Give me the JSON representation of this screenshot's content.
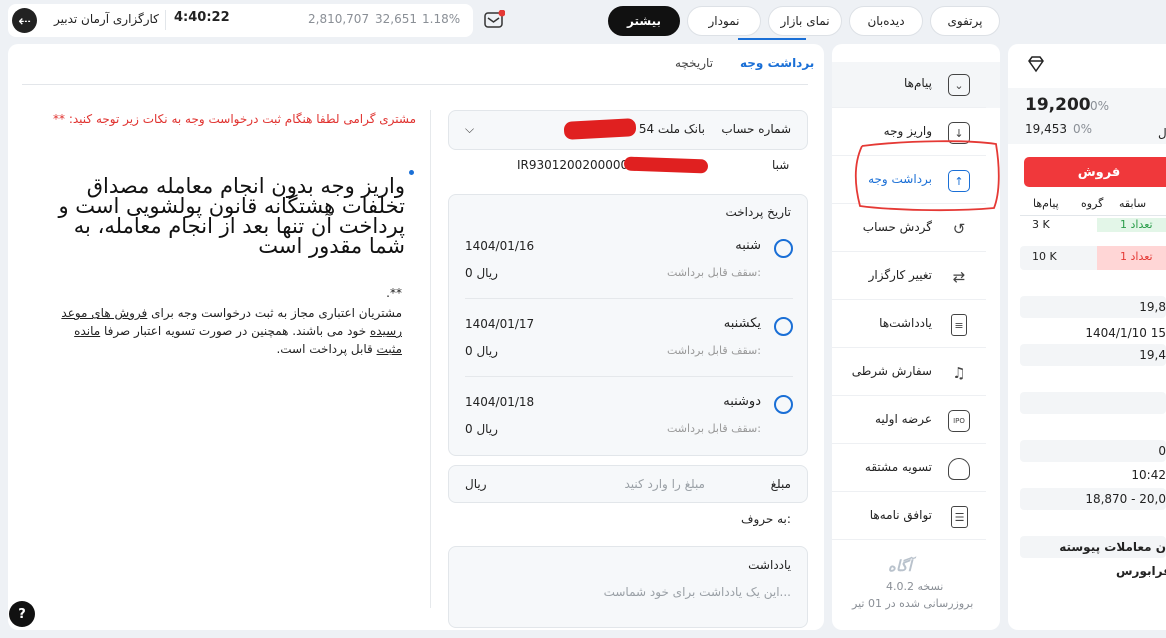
{
  "topbar": {
    "broker": "کارگزاری آرمان تدبیر",
    "time": "4:40:22",
    "index_value": "2,810,707",
    "index_change": "32,651",
    "index_percent": "1.18%"
  },
  "nav": {
    "more": "بیشتر",
    "chart": "نمودار",
    "market_view": "نمای بازار",
    "watch": "دیده‌بان",
    "portfolio": "پرتفوی"
  },
  "tabs": {
    "withdraw": "برداشت وجه",
    "history": "تاریخچه"
  },
  "notice": {
    "intro": "مشتری گرامی لطفا هنگام ثبت درخواست وجه به نکات زیر توجه کنید: **",
    "big_text": "واریز وجه بدون انجام معامله مصداق تخلفات هشتگانه قانون پولشویی است و پرداخت آن تنها بعد از انجام معامله، به شما مقدور است",
    "stars": "**.",
    "p1_a": "مشتریان اعتباری مجاز به ثبت درخواست وجه برای",
    "p1_link": "فروش های موعد رسیده",
    "p1_b": "خود می باشند. همچنین در صورت تسویه اعتبار صرفا",
    "p1_link2": "مانده مثبت",
    "p1_c": "قابل پرداخت است."
  },
  "form": {
    "account_label": "شماره حساب",
    "account_value": "بانک ملت 54",
    "sheba_label": "شبا",
    "sheba_value": "IR9301200200000",
    "pay_date_label": "تاریخ پرداخت",
    "dates": [
      {
        "day": "شنبه",
        "date": "1404/01/16",
        "cap_label": "سقف قابل برداشت:",
        "cap": "0 ریال"
      },
      {
        "day": "یکشنبه",
        "date": "1404/01/17",
        "cap_label": "سقف قابل برداشت:",
        "cap": "0 ریال"
      },
      {
        "day": "دوشنبه",
        "date": "1404/01/18",
        "cap_label": "سقف قابل برداشت:",
        "cap": "0 ریال"
      }
    ],
    "amount_label": "مبلغ",
    "amount_placeholder": "مبلغ را وارد کنید",
    "amount_unit": "ریال",
    "in_words": "به حروف:",
    "note_label": "یادداشت",
    "note_placeholder": "این یک یادداشت برای خود شماست..."
  },
  "menu": {
    "items": [
      {
        "label": "پیام‌ها",
        "icon": "chevron-down-icon"
      },
      {
        "label": "واریز وجه",
        "icon": "arrow-down-icon"
      },
      {
        "label": "برداشت وجه",
        "icon": "arrow-up-icon"
      },
      {
        "label": "گردش حساب",
        "icon": "history-icon"
      },
      {
        "label": "تغییر کارگزار",
        "icon": "swap-icon"
      },
      {
        "label": "یادداشت‌ها",
        "icon": "notes-icon"
      },
      {
        "label": "سفارش شرطی",
        "icon": "bell-icon"
      },
      {
        "label": "عرضه اولیه",
        "icon": "ipo-icon"
      },
      {
        "label": "تسویه مشتقه",
        "icon": "settle-icon"
      },
      {
        "label": "توافق نامه‌ها",
        "icon": "agreement-icon"
      }
    ],
    "logo": "آگاه",
    "version": "نسخه 4.0.2",
    "updated": "بروزرسانی شده در 01 تیر"
  },
  "right": {
    "price": "19,200",
    "price_pct": "0%",
    "price2": "19,453",
    "price2_pct": "0%",
    "sell": "فروش",
    "tab_history": "سابقه",
    "tab_group": "گروه",
    "tab_messages": "پیام‌ها",
    "r1_left": "3 K",
    "r1_right": "تعداد 1",
    "r2_left": "10 K",
    "r2_right": "تعداد 1",
    "v1": "19,8",
    "v2": "1404/1/10 15",
    "v3": "19,4",
    "v4": "0",
    "v5": "10:42",
    "v6": "18,870 - 20,0",
    "footer1": "ن معاملات پیوسته",
    "footer2": "فرابورس"
  },
  "colors": {
    "accent": "#1a6fd6",
    "sell": "#f0383b",
    "notice": "#e0322f"
  }
}
